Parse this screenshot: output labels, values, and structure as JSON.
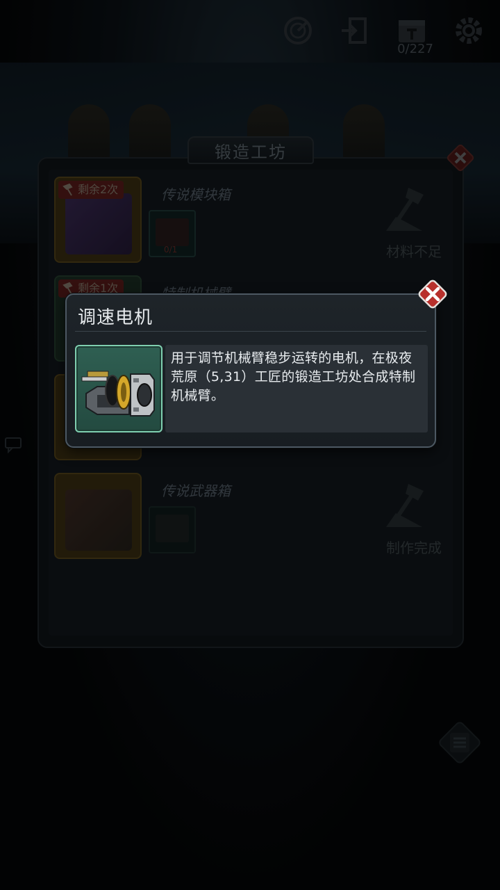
{
  "top_bar": {
    "counter": "0/227",
    "icons": [
      "radar-icon",
      "exit-door-icon",
      "calendar-icon",
      "gear-icon"
    ]
  },
  "panel": {
    "title": "锻造工坊",
    "rows": [
      {
        "badge": "剩余2次",
        "name": "传说模块箱",
        "material_count": "0/1",
        "status": "材料不足"
      },
      {
        "badge": "剩余1次",
        "name": "特制机械臂",
        "material_count": "",
        "status": ""
      },
      {
        "badge": "",
        "name": "",
        "material_count": "",
        "status": ""
      },
      {
        "badge": "",
        "name": "传说武器箱",
        "material_count": "",
        "status": "制作完成"
      }
    ]
  },
  "popup": {
    "title": "调速电机",
    "description": "用于调节机械臂稳步运转的电机，在极夜荒原（5,31）工匠的锻造工坊处合成特制机械臂。"
  },
  "colors": {
    "close_red": "#b8302c",
    "item_frame_green": "#2f5f52",
    "item_frame_border": "#7fcfb0",
    "gold_thumb": "#3b3012"
  }
}
